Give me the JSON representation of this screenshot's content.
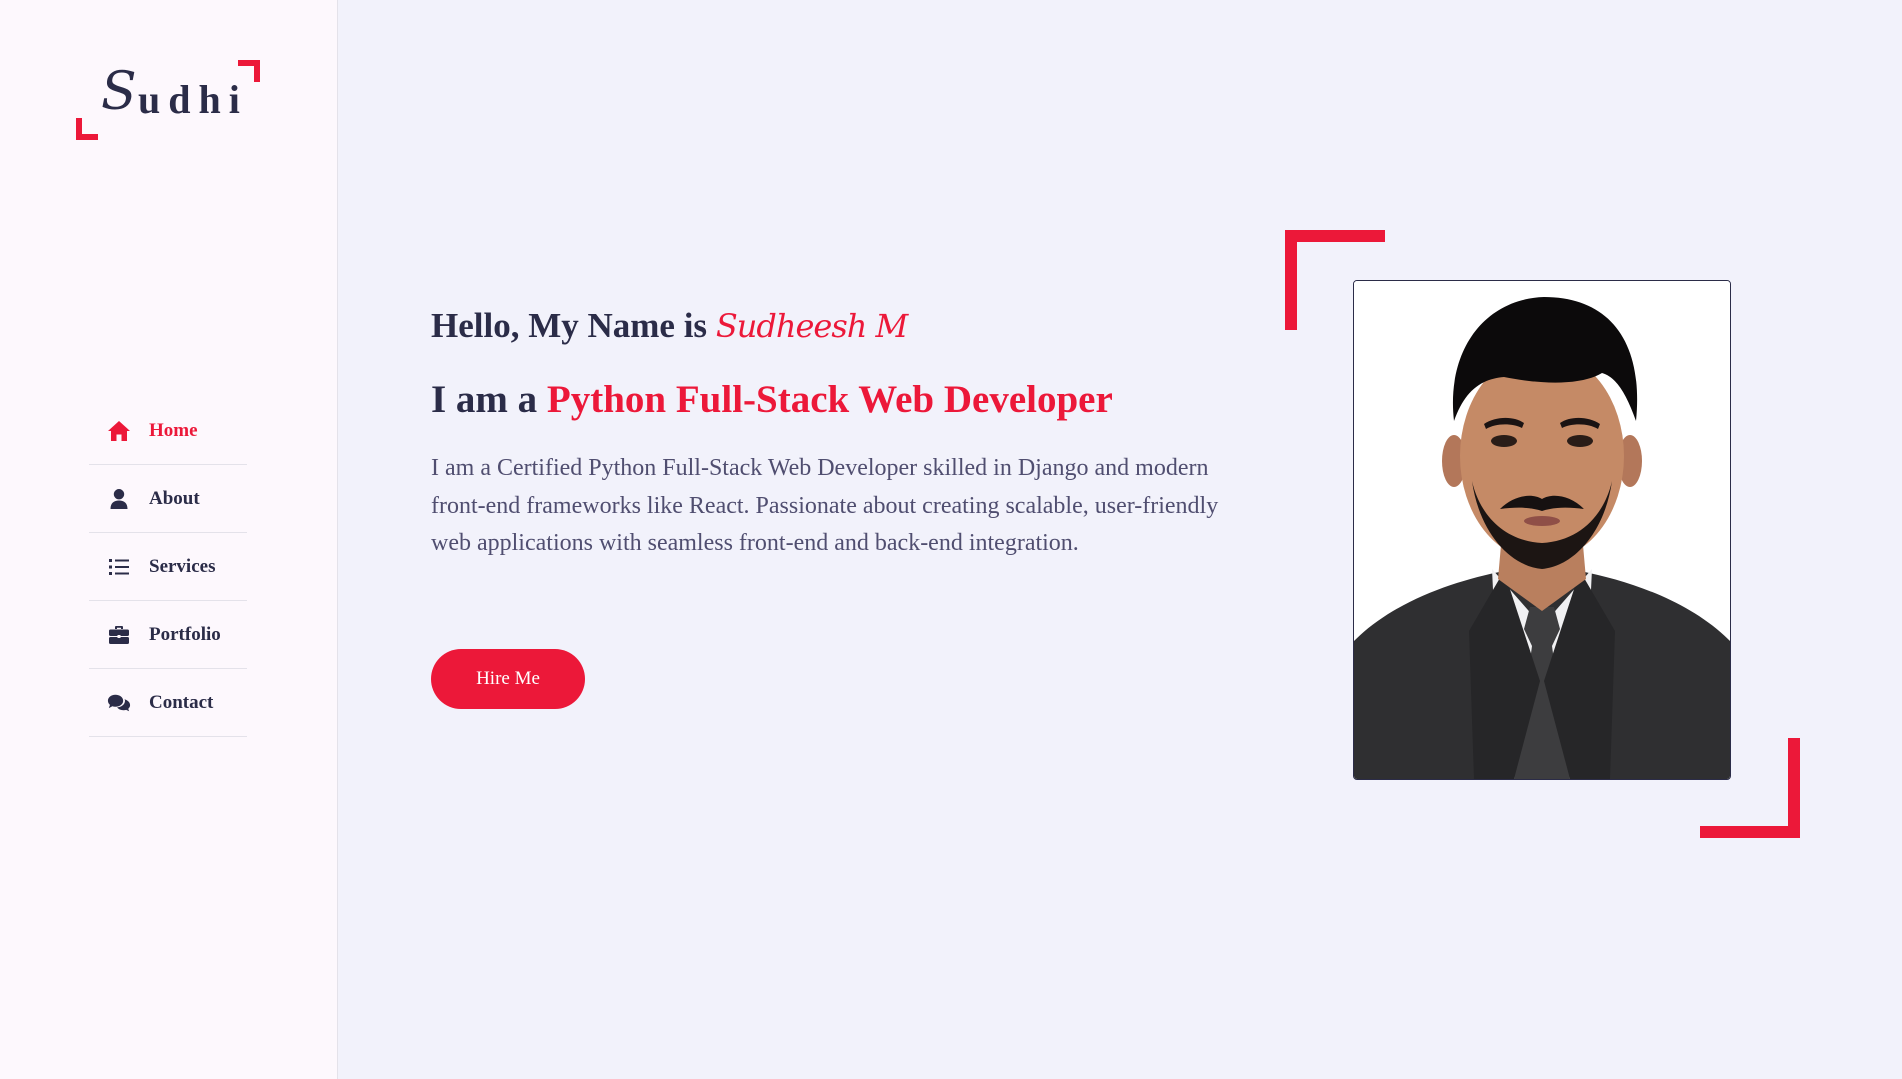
{
  "logo": {
    "initial": "S",
    "rest": "udhi"
  },
  "nav": {
    "items": [
      {
        "label": "Home",
        "icon": "home-icon",
        "active": true
      },
      {
        "label": "About",
        "icon": "user-icon",
        "active": false
      },
      {
        "label": "Services",
        "icon": "list-icon",
        "active": false
      },
      {
        "label": "Portfolio",
        "icon": "briefcase-icon",
        "active": false
      },
      {
        "label": "Contact",
        "icon": "comments-icon",
        "active": false
      }
    ]
  },
  "hero": {
    "greeting_prefix": "Hello, My Name is",
    "name": "Sudheesh M",
    "role_prefix": "I am a",
    "role_highlight": "Python Full-Stack Web Developer",
    "description": "I am a Certified Python Full-Stack Web Developer skilled in Django and modern front-end frameworks like React. Passionate about creating scalable, user-friendly web applications with seamless front-end and back-end integration.",
    "button_label": "Hire Me"
  },
  "colors": {
    "accent": "#ec1839",
    "text_dark": "#2b2c48",
    "text_body": "#504e70",
    "background": "#f2f2fb",
    "sidebar_background": "#fdf8fd"
  }
}
